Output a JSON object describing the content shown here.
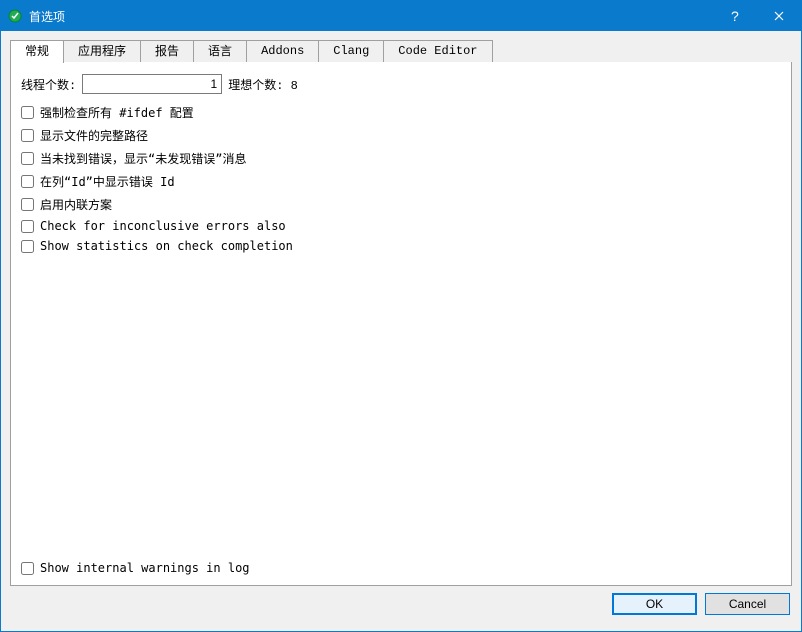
{
  "window": {
    "title": "首选项"
  },
  "tabs": [
    {
      "label": "常规"
    },
    {
      "label": "应用程序"
    },
    {
      "label": "报告"
    },
    {
      "label": "语言"
    },
    {
      "label": "Addons"
    },
    {
      "label": "Clang"
    },
    {
      "label": "Code Editor"
    }
  ],
  "general": {
    "threads_label": "线程个数:",
    "threads_value": "1",
    "ideal_label": "理想个数: 8",
    "checks": [
      {
        "label": "强制检查所有 #ifdef 配置"
      },
      {
        "label": "显示文件的完整路径"
      },
      {
        "label": "当未找到错误，显示“未发现错误”消息"
      },
      {
        "label": "在列“Id”中显示错误 Id"
      },
      {
        "label": "启用内联方案"
      },
      {
        "label": "Check for inconclusive errors also"
      },
      {
        "label": "Show statistics on check completion"
      }
    ],
    "bottom_check": {
      "label": "Show internal warnings in log"
    }
  },
  "footer": {
    "ok": "OK",
    "cancel": "Cancel"
  }
}
